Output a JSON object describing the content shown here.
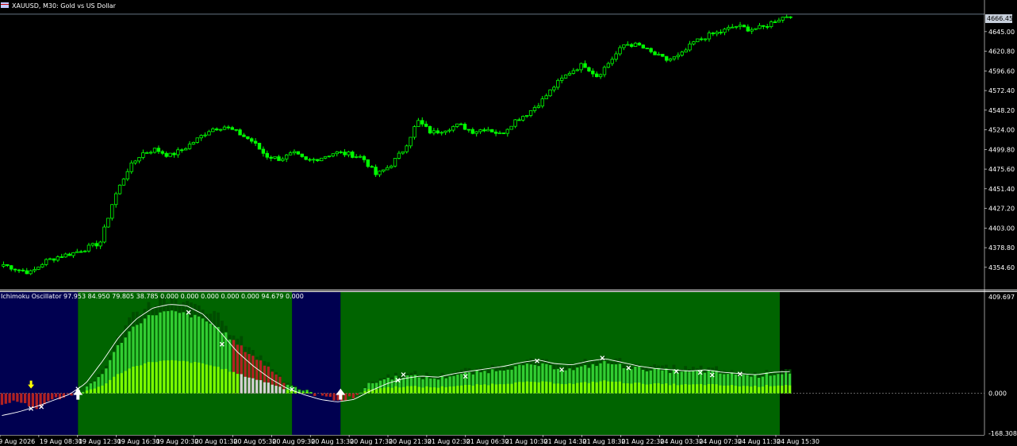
{
  "header": {
    "symbol_line": "XAUUSD, M30:  Gold vs US Dollar"
  },
  "current_price_label": "4666.45",
  "indicator_header": "Ichimoku Oscillator 97.953 84.950 79.805 38.785 0.000 0.000 0.000 0.000 0.000 94.679 0.000",
  "colors": {
    "background": "#000000",
    "candle": "#00ff00",
    "grid_line": "#ffffff",
    "osc_bg_green": "#006400",
    "osc_bg_blue": "#000050",
    "osc_bar_bright": "#32cd32",
    "osc_bar_light": "#7cfc00",
    "osc_bar_dark": "#004d00",
    "osc_bar_red": "#b22222",
    "osc_bar_grey": "#d3d3d3",
    "signal_line": "#ffffff",
    "arrow_up": "#ffffff",
    "arrow_down": "#ffff00"
  },
  "chart_data": [
    {
      "type": "candlestick",
      "title": "XAUUSD, M30:  Gold vs US Dollar",
      "y_ticks": [
        "4645.00",
        "4620.80",
        "4596.60",
        "4572.40",
        "4548.20",
        "4524.00",
        "4499.80",
        "4475.60",
        "4451.40",
        "4427.20",
        "4403.00",
        "4378.80",
        "4354.60"
      ],
      "x_ticks": [
        "19 Aug 2026",
        "19 Aug 08:30",
        "19 Aug 12:30",
        "19 Aug 16:30",
        "19 Aug 20:30",
        "20 Aug 01:30",
        "20 Aug 05:30",
        "20 Aug 09:30",
        "20 Aug 13:30",
        "20 Aug 17:30",
        "20 Aug 21:30",
        "21 Aug 02:30",
        "21 Aug 06:30",
        "21 Aug 10:30",
        "21 Aug 14:30",
        "21 Aug 18:30",
        "21 Aug 22:30",
        "24 Aug 03:30",
        "24 Aug 07:30",
        "24 Aug 11:30",
        "24 Aug 15:30"
      ],
      "ylim": [
        4330,
        4682
      ],
      "close_anchor": [
        4358,
        4352,
        4348,
        4362,
        4368,
        4372,
        4378,
        4385,
        4440,
        4475,
        4495,
        4500,
        4492,
        4500,
        4512,
        4525,
        4528,
        4520,
        4510,
        4492,
        4488,
        4495,
        4485,
        4490,
        4496,
        4494,
        4490,
        4468,
        4480,
        4500,
        4535,
        4520,
        4525,
        4530,
        4522,
        4526,
        4518,
        4535,
        4545,
        4560,
        4580,
        4595,
        4605,
        4590,
        4610,
        4630,
        4628,
        4618,
        4610,
        4615,
        4632,
        4640,
        4645,
        4652,
        4648,
        4650,
        4660,
        4666
      ],
      "candle_count": 204,
      "current_price": 4666.45
    },
    {
      "type": "bar",
      "title": "Ichimoku Oscillator",
      "y_ticks": [
        "409.697",
        "0.000",
        "-168.308"
      ],
      "ylim": [
        -168.308,
        409.697
      ],
      "histogram_anchor": [
        -40,
        -35,
        -60,
        -20,
        -10,
        15,
        80,
        200,
        280,
        320,
        330,
        320,
        300,
        260,
        200,
        150,
        100,
        40,
        10,
        -10,
        -30,
        -15,
        40,
        60,
        70,
        65,
        60,
        75,
        80,
        90,
        100,
        110,
        115,
        105,
        95,
        110,
        125,
        110,
        100,
        95,
        90,
        85,
        90,
        80,
        75,
        70,
        80,
        85
      ],
      "signal_anchor": [
        -90,
        -75,
        -55,
        -30,
        -5,
        40,
        130,
        230,
        300,
        345,
        360,
        355,
        320,
        250,
        170,
        110,
        60,
        20,
        -5,
        -25,
        -35,
        -25,
        10,
        40,
        60,
        70,
        65,
        80,
        90,
        100,
        110,
        125,
        135,
        120,
        115,
        130,
        140,
        125,
        110,
        100,
        95,
        90,
        95,
        85,
        80,
        75,
        85,
        88
      ],
      "blue_zones": [
        [
          0,
          0.098
        ],
        [
          0.367,
          0.428
        ]
      ],
      "green_zones": [
        [
          0.098,
          0.367
        ],
        [
          0.428,
          0.98
        ]
      ],
      "up_arrows": [
        0.098,
        0.428
      ],
      "down_arrows": [
        0.039
      ],
      "x_markers": [
        0.039,
        0.052,
        0.098,
        0.237,
        0.279,
        0.367,
        0.5,
        0.507,
        0.585,
        0.675,
        0.706,
        0.757,
        0.79,
        0.85,
        0.88,
        0.895,
        0.93
      ]
    }
  ]
}
